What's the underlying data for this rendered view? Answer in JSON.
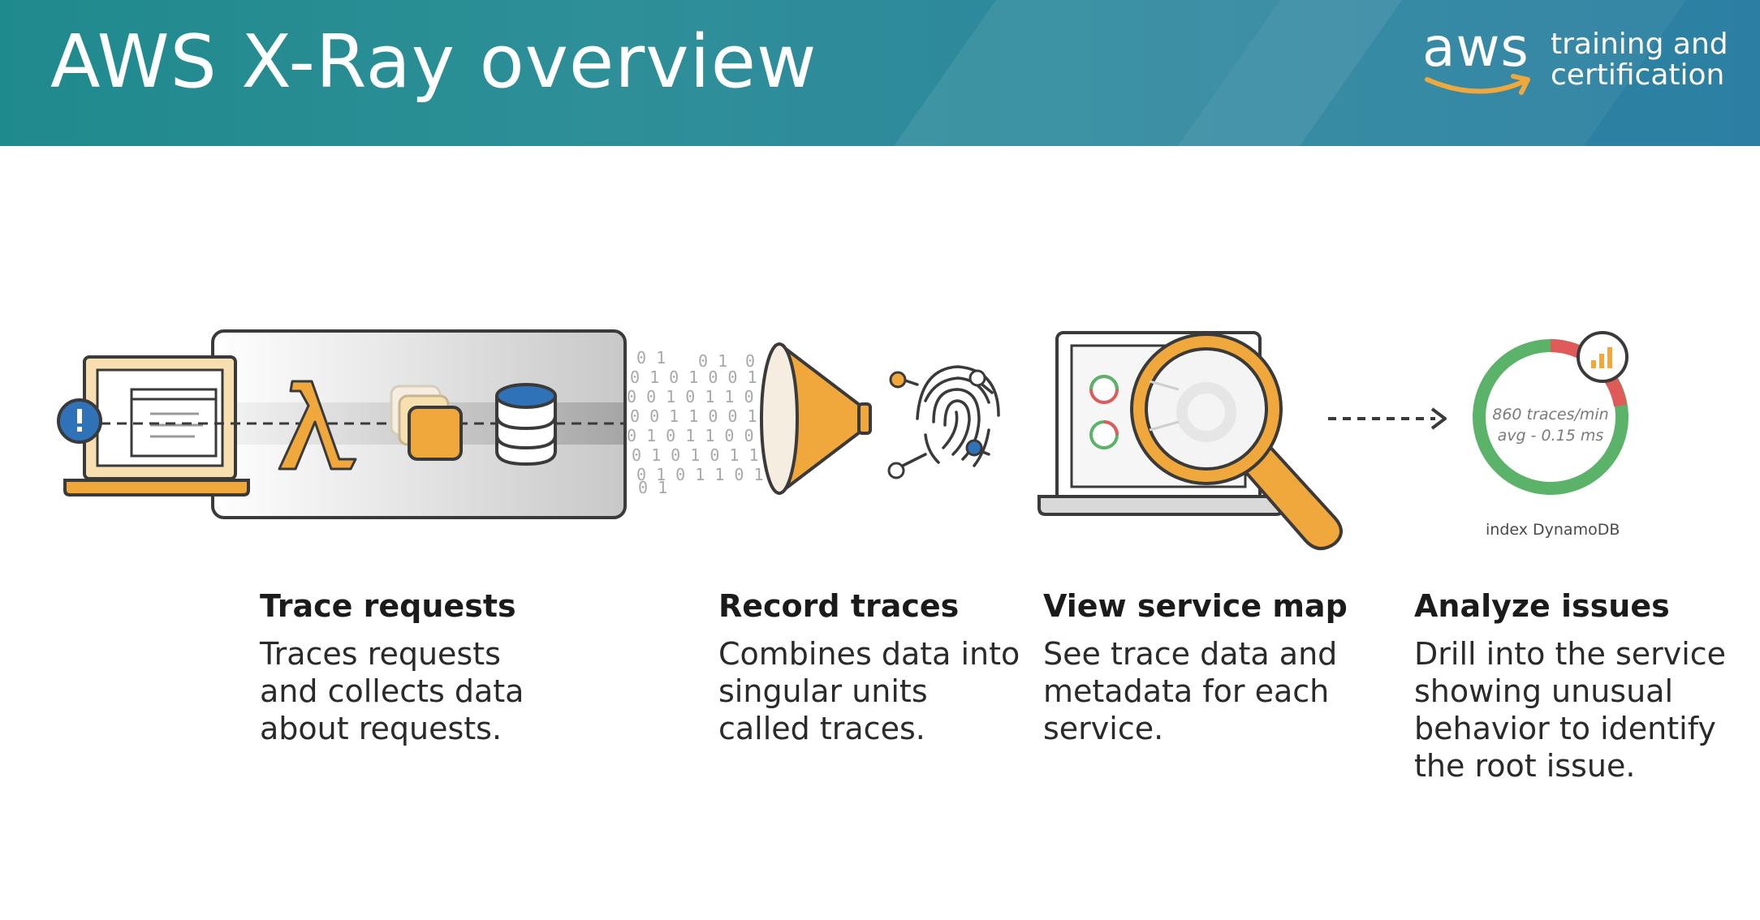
{
  "header": {
    "title": "AWS X-Ray overview",
    "logo_word": "aws",
    "logo_tagline_line1": "training and",
    "logo_tagline_line2": "certification"
  },
  "colors": {
    "header_teal": "#1f8a8d",
    "accent_orange": "#f0a83c",
    "alert_blue": "#2f72b8",
    "ring_green": "#5bb36a",
    "ring_red": "#e05a5a"
  },
  "icons": [
    "alert-icon",
    "laptop-icon",
    "lambda-icon",
    "container-icon",
    "database-icon",
    "binary-stream-icon",
    "funnel-icon",
    "fingerprint-icon",
    "magnifier-icon",
    "dashed-arrow-icon",
    "metrics-ring-icon",
    "bar-chart-icon"
  ],
  "service_ring": {
    "line1": "860 traces/min",
    "line2": "avg - 0.15 ms",
    "caption": "index DynamoDB"
  },
  "steps": [
    {
      "title": "Trace requests",
      "desc": "Traces requests and collects data about requests."
    },
    {
      "title": "Record traces",
      "desc": "Combines data into singular units called traces."
    },
    {
      "title": "View service map",
      "desc": "See trace data and metadata for each service."
    },
    {
      "title": "Analyze issues",
      "desc": "Drill into the service showing unusual behavior to identify the root issue."
    }
  ]
}
